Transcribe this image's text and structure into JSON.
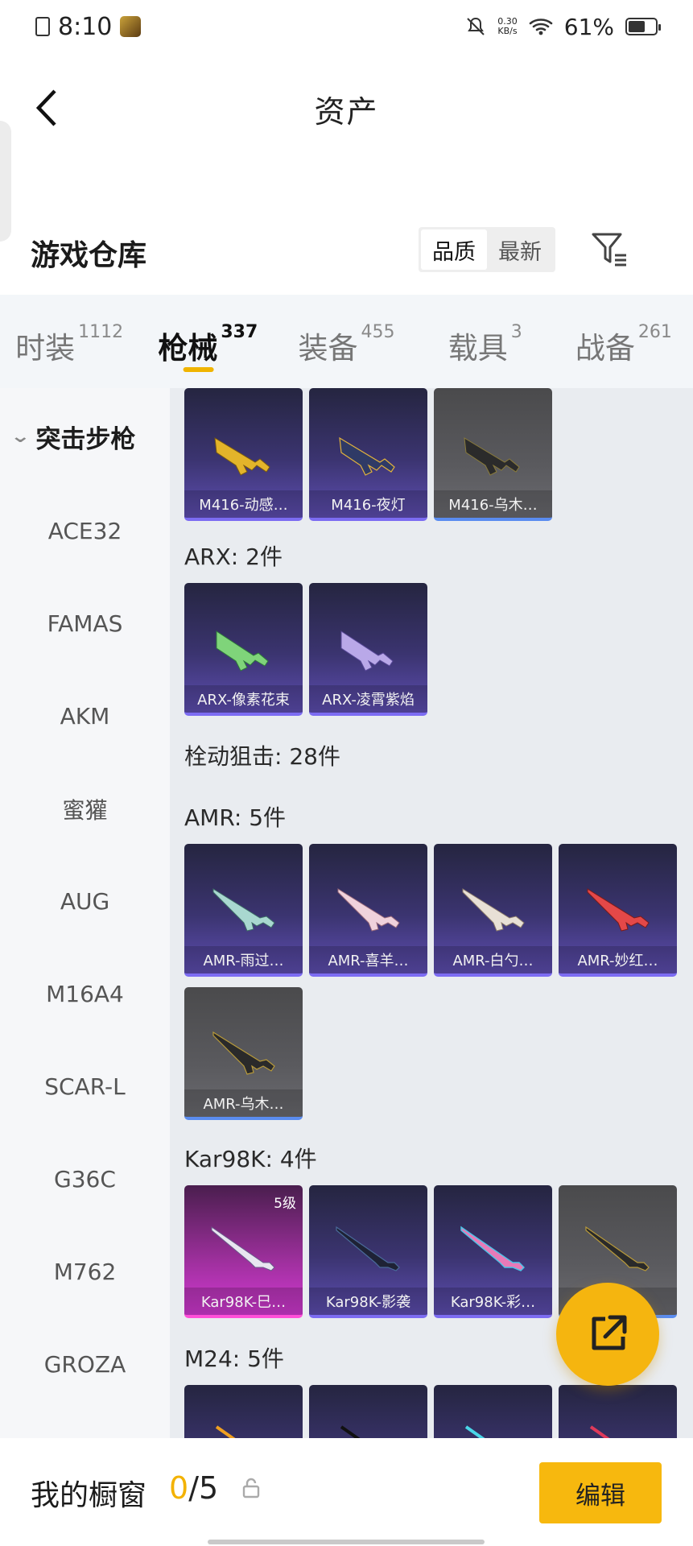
{
  "status_bar": {
    "time": "8:10",
    "net_speed_value": "0.30",
    "net_speed_unit": "KB/s",
    "battery": "61%"
  },
  "header": {
    "title": "资产"
  },
  "warehouse": {
    "title": "游戏仓库",
    "sort_options": [
      "品质",
      "最新"
    ]
  },
  "tabs": [
    {
      "label": "时装",
      "count": "1112"
    },
    {
      "label": "枪械",
      "count": "337"
    },
    {
      "label": "装备",
      "count": "455"
    },
    {
      "label": "载具",
      "count": "3"
    },
    {
      "label": "战备",
      "count": "261"
    }
  ],
  "sidebar": {
    "group": "突击步枪",
    "items": [
      "ACE32",
      "FAMAS",
      "AKM",
      "蜜獾",
      "AUG",
      "M16A4",
      "SCAR-L",
      "G36C",
      "M762",
      "GROZA"
    ]
  },
  "sections": {
    "arx": "ARX: 2件",
    "bolt": "栓动狙击: 28件",
    "amr": "AMR: 5件",
    "kar": "Kar98K: 4件",
    "m24": "M24: 5件"
  },
  "cards": {
    "m416": [
      "M416-动感…",
      "M416-夜灯",
      "M416-乌木…"
    ],
    "arx": [
      "ARX-像素花束",
      "ARX-凌霄紫焰"
    ],
    "amr": [
      "AMR-雨过…",
      "AMR-喜羊…",
      "AMR-白勺…",
      "AMR-妙红…",
      "AMR-乌木…"
    ],
    "kar": [
      "Kar98K-巳…",
      "Kar98K-影袭",
      "Kar98K-彩…",
      ""
    ],
    "kar_level": "5级"
  },
  "bottom": {
    "showcase_label": "我的橱窗",
    "showcase_current": "0",
    "showcase_total": "/5",
    "edit_label": "编辑"
  },
  "colors": {
    "accent": "#f5b50f",
    "card_purple": "#5e4eb2",
    "card_gray": "#5a5a5e",
    "card_pink": "#d33ad4"
  }
}
